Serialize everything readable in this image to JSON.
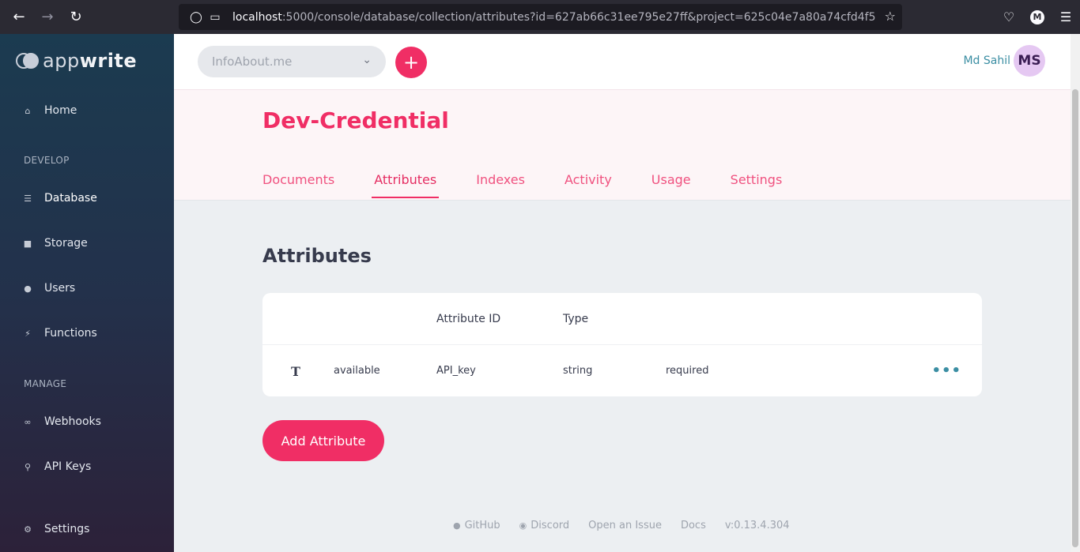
{
  "browser": {
    "url_host": "localhost",
    "url_rest": ":5000/console/database/collection/attributes?id=627ab66c31ee795e27ff&project=625c04e7a80a74cfd4f5",
    "account_initial": "M"
  },
  "sidebar": {
    "logo_light": "app",
    "logo_bold": "write",
    "home": "Home",
    "section_develop": "DEVELOP",
    "database": "Database",
    "storage": "Storage",
    "users": "Users",
    "functions": "Functions",
    "section_manage": "MANAGE",
    "webhooks": "Webhooks",
    "api_keys": "API Keys",
    "settings": "Settings"
  },
  "topbar": {
    "project": "InfoAbout.me",
    "plus": "+",
    "user_name": "Md Sahil",
    "avatar_initials": "MS"
  },
  "collection": {
    "title": "Dev-Credential",
    "tabs": [
      "Documents",
      "Attributes",
      "Indexes",
      "Activity",
      "Usage",
      "Settings"
    ],
    "active_tab": "Attributes"
  },
  "attributes": {
    "heading": "Attributes",
    "columns": {
      "id": "Attribute ID",
      "type": "Type"
    },
    "rows": [
      {
        "type_icon": "T",
        "status": "available",
        "id": "API_key",
        "type": "string",
        "required": "required"
      }
    ],
    "add_button": "Add Attribute"
  },
  "footer": {
    "github": "GitHub",
    "discord": "Discord",
    "issue": "Open an Issue",
    "docs": "Docs",
    "version": "v:0.13.4.304"
  },
  "colors": {
    "accent": "#f02e65",
    "status_available": "#1bbf61",
    "status_required": "#f0465c",
    "link": "#3b8ea3"
  }
}
